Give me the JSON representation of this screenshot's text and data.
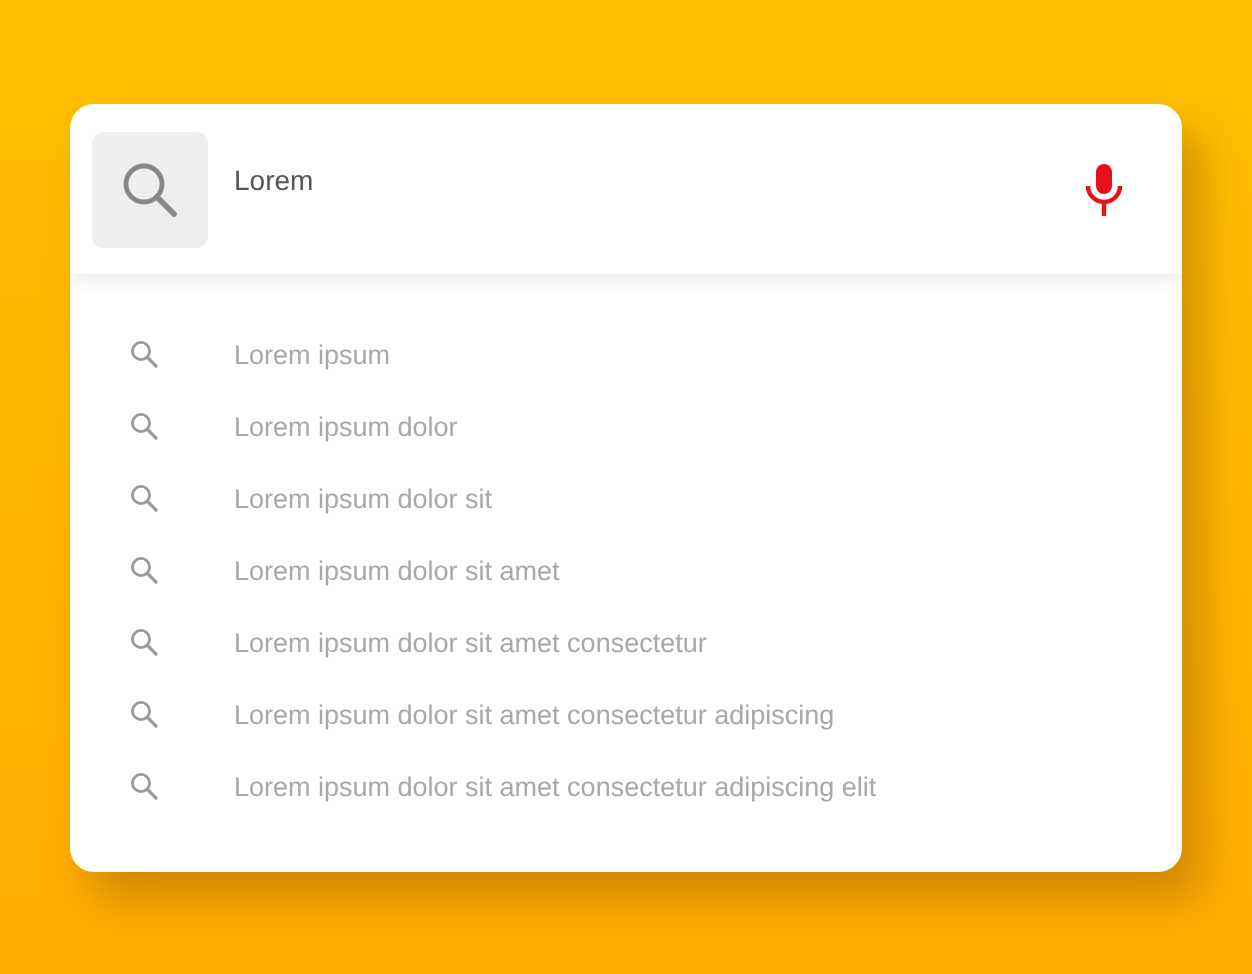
{
  "search": {
    "value": "Lorem"
  },
  "suggestions": [
    "Lorem ipsum",
    "Lorem ipsum dolor",
    "Lorem ipsum dolor sit",
    "Lorem ipsum dolor sit amet",
    "Lorem ipsum dolor sit amet consectetur",
    "Lorem ipsum dolor sit amet consectetur adipiscing",
    "Lorem ipsum dolor sit amet consectetur adipiscing elit"
  ]
}
